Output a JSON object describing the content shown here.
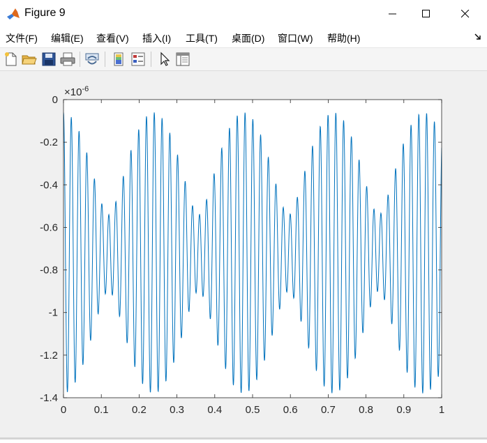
{
  "window": {
    "title": "Figure 9",
    "controls": [
      "minimize",
      "maximize",
      "close"
    ]
  },
  "menubar": {
    "items": [
      {
        "label": "文件(F)"
      },
      {
        "label": "编辑(E)"
      },
      {
        "label": "查看(V)"
      },
      {
        "label": "插入(I)"
      },
      {
        "label": "工具(T)"
      },
      {
        "label": "桌面(D)"
      },
      {
        "label": "窗口(W)"
      },
      {
        "label": "帮助(H)"
      }
    ]
  },
  "toolbar": {
    "buttons": [
      "new-figure-icon",
      "open-file-icon",
      "save-icon",
      "print-icon",
      "link-plot-icon",
      "colorbar-icon",
      "legend-icon",
      "edit-plot-arrow-icon",
      "property-inspector-icon"
    ]
  },
  "colors": {
    "line": "#0072bd",
    "axes_bg": "#ffffff",
    "figure_bg": "#f0f0f0",
    "axis": "#262626"
  },
  "chart_data": {
    "type": "line",
    "title": "",
    "xlabel": "",
    "ylabel": "",
    "y_exponent_label": "×10",
    "y_exponent": "-6",
    "xlim": [
      0,
      1
    ],
    "ylim": [
      -1.4,
      0
    ],
    "xticks": [
      "0",
      "0.1",
      "0.2",
      "0.3",
      "0.4",
      "0.5",
      "0.6",
      "0.7",
      "0.8",
      "0.9",
      "1"
    ],
    "yticks": [
      "0",
      "-0.2",
      "-0.4",
      "-0.6",
      "-0.8",
      "-1",
      "-1.2",
      "-1.4"
    ],
    "grid": false,
    "legend": "none",
    "series": [
      {
        "signal": {
          "offset": -0.72,
          "components": [
            {
              "amplitude": 0.42,
              "frequency_hz": 50,
              "phase_rad": 1.5708
            },
            {
              "amplitude": 0.24,
              "frequency_hz": 45.8,
              "phase_rad": 1.5708
            }
          ]
        },
        "samples": 1600
      }
    ]
  }
}
